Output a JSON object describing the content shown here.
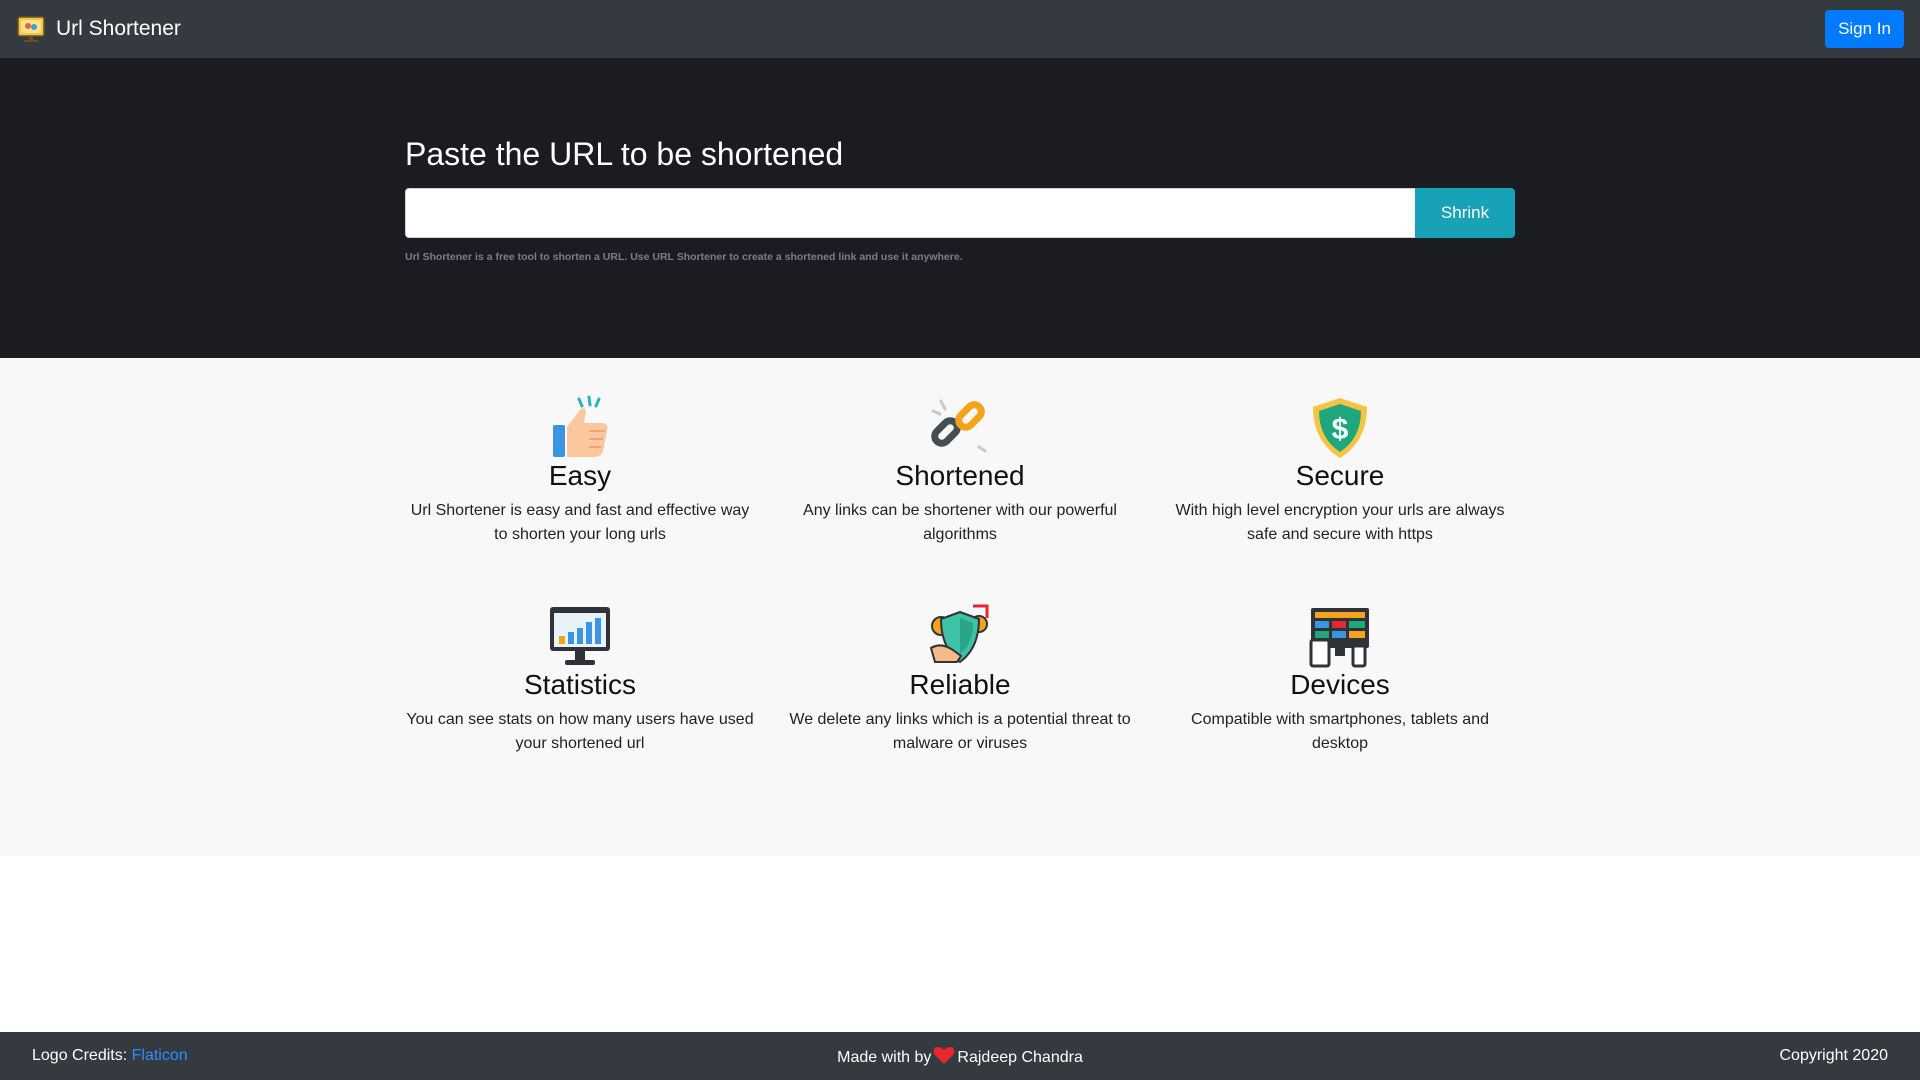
{
  "navbar": {
    "brand": "Url Shortener",
    "logo_icon": "monitor-link-logo-icon",
    "signin_label": "Sign In",
    "colors": {
      "background": "#343a40",
      "signin": "#007bff"
    }
  },
  "hero": {
    "title": "Paste the URL to be shortened",
    "input_value": "",
    "input_placeholder": "",
    "shrink_label": "Shrink",
    "note": "Url Shortener is a free tool to shorten a URL. Use URL Shortener to create a shortened link and use it anywhere.",
    "colors": {
      "background": "#1b1b22",
      "shrink": "#17a2b8"
    }
  },
  "features": [
    {
      "icon": "thumbs-up-icon",
      "title": "Easy",
      "desc": "Url Shortener is easy and fast and effective way to shorten your long urls"
    },
    {
      "icon": "chain-link-icon",
      "title": "Shortened",
      "desc": "Any links can be shortener with our powerful algorithms"
    },
    {
      "icon": "shield-dollar-icon",
      "title": "Secure",
      "desc": "With high level encryption your urls are always safe and secure with https"
    },
    {
      "icon": "monitor-chart-icon",
      "title": "Statistics",
      "desc": "You can see stats on how many users have used your shortened url"
    },
    {
      "icon": "shield-gears-icon",
      "title": "Reliable",
      "desc": "We delete any links which is a potential threat to malware or viruses"
    },
    {
      "icon": "devices-icon",
      "title": "Devices",
      "desc": "Compatible with smartphones, tablets and desktop"
    }
  ],
  "footer": {
    "credits_label": "Logo Credits:",
    "credits_link": "Flaticon",
    "made_with": "Made with by",
    "author": "Rajdeep Chandra",
    "heart_icon": "heart-icon",
    "copyright": "Copyright 2020",
    "colors": {
      "link": "#2f8cff",
      "heart": "#e8262e"
    }
  }
}
